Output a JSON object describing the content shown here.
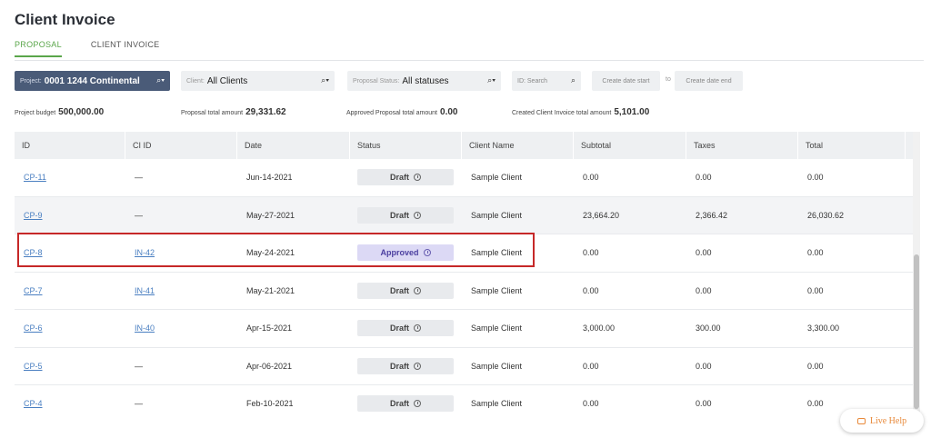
{
  "page": {
    "title": "Client Invoice"
  },
  "tabs": [
    {
      "label": "PROPOSAL",
      "active": true
    },
    {
      "label": "CLIENT INVOICE",
      "active": false
    }
  ],
  "filters": {
    "project": {
      "label": "Project:",
      "value": "0001 1244 Continental",
      "icon": "search-icon"
    },
    "client": {
      "label": "Client:",
      "value": "All Clients",
      "icon": "search-icon"
    },
    "status": {
      "label": "Proposal Status:",
      "value": "All statuses",
      "icon": "search-icon"
    },
    "id_search": {
      "placeholder": "ID: Search",
      "icon": "search-icon"
    },
    "date_start": {
      "placeholder": "Create date start"
    },
    "to_label": "to",
    "date_end": {
      "placeholder": "Create date end"
    }
  },
  "summary": {
    "project_budget": {
      "label": "Project budget",
      "value": "500,000.00"
    },
    "proposal_total": {
      "label": "Proposal total amount",
      "value": "29,331.62"
    },
    "approved_total": {
      "label": "Approved Proposal total amount",
      "value": "0.00"
    },
    "invoice_total": {
      "label": "Created Client Invoice total amount",
      "value": "5,101.00"
    }
  },
  "table": {
    "columns": [
      "ID",
      "CI ID",
      "Date",
      "Status",
      "Client Name",
      "Subtotal",
      "Taxes",
      "Total"
    ],
    "rows": [
      {
        "id": "CP-11",
        "ci_id": "—",
        "date": "Jun-14-2021",
        "status": "Draft",
        "client": "Sample Client",
        "subtotal": "0.00",
        "taxes": "0.00",
        "total": "0.00"
      },
      {
        "id": "CP-9",
        "ci_id": "—",
        "date": "May-27-2021",
        "status": "Draft",
        "client": "Sample Client",
        "subtotal": "23,664.20",
        "taxes": "2,366.42",
        "total": "26,030.62"
      },
      {
        "id": "CP-8",
        "ci_id": "IN-42",
        "date": "May-24-2021",
        "status": "Approved",
        "client": "Sample Client",
        "subtotal": "0.00",
        "taxes": "0.00",
        "total": "0.00"
      },
      {
        "id": "CP-7",
        "ci_id": "IN-41",
        "date": "May-21-2021",
        "status": "Draft",
        "client": "Sample Client",
        "subtotal": "0.00",
        "taxes": "0.00",
        "total": "0.00"
      },
      {
        "id": "CP-6",
        "ci_id": "IN-40",
        "date": "Apr-15-2021",
        "status": "Draft",
        "client": "Sample Client",
        "subtotal": "3,000.00",
        "taxes": "300.00",
        "total": "3,300.00"
      },
      {
        "id": "CP-5",
        "ci_id": "—",
        "date": "Apr-06-2021",
        "status": "Draft",
        "client": "Sample Client",
        "subtotal": "0.00",
        "taxes": "0.00",
        "total": "0.00"
      },
      {
        "id": "CP-4",
        "ci_id": "—",
        "date": "Feb-10-2021",
        "status": "Draft",
        "client": "Sample Client",
        "subtotal": "0.00",
        "taxes": "0.00",
        "total": "0.00"
      }
    ]
  },
  "live_help": {
    "label": "Live Help",
    "icon": "chat-bubble-icon"
  },
  "colors": {
    "accent_green": "#5aa64a",
    "project_filter_bg": "#4a5b78",
    "link": "#4a7fc1",
    "approved_badge": "#dcd9f5",
    "highlight_border": "#c62828",
    "live_help": "#e8893a"
  }
}
